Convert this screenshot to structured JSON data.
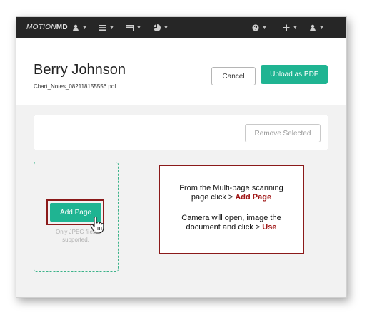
{
  "navbar": {
    "logo_light": "MOTION",
    "logo_bold": "MD",
    "items_left": [
      {
        "icon": "user-icon"
      },
      {
        "icon": "list-icon"
      },
      {
        "icon": "card-icon"
      },
      {
        "icon": "chart-icon"
      }
    ],
    "items_right": [
      {
        "icon": "help-icon"
      },
      {
        "icon": "plus-icon"
      },
      {
        "icon": "user-icon"
      }
    ],
    "caret": "▼"
  },
  "header": {
    "patient_name": "Berry Johnson",
    "filename": "Chart_Notes_082118155556.pdf",
    "cancel_label": "Cancel",
    "upload_label": "Upload as PDF"
  },
  "panel": {
    "remove_label": "Remove Selected"
  },
  "dropzone": {
    "add_page_label": "Add Page",
    "hint_line1": "Only JPEG files",
    "hint_line2": "supported."
  },
  "callout": {
    "line1": "From the Multi-page scanning",
    "line2_prefix": "page click > ",
    "line2_highlight": "Add Page",
    "line3": "Camera will open, image the",
    "line4_prefix": "document and click > ",
    "line4_highlight": "Use"
  },
  "colors": {
    "accent": "#1fb492",
    "annotation_red": "#8b1a1a",
    "navbar": "#262626"
  }
}
